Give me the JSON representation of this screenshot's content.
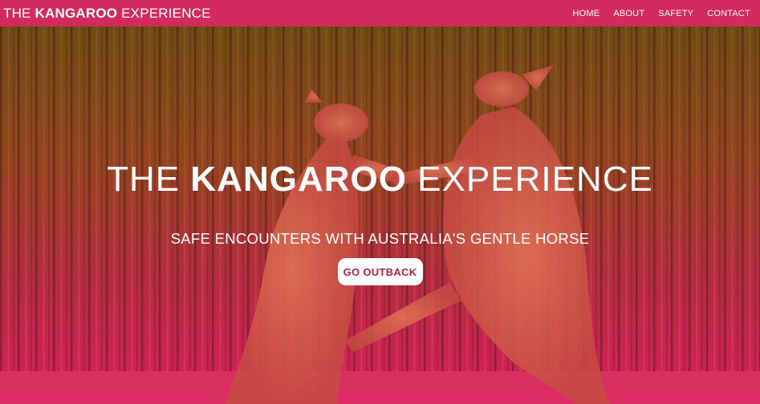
{
  "navbar": {
    "brand": {
      "prefix": "THE ",
      "bold": "KANGAROO",
      "suffix": " EXPERIENCE"
    },
    "links": [
      {
        "label": "HOME"
      },
      {
        "label": "ABOUT"
      },
      {
        "label": "SAFETY"
      },
      {
        "label": "CONTACT"
      }
    ]
  },
  "hero": {
    "title": {
      "prefix": "THE ",
      "bold": "KANGAROO",
      "suffix": " EXPERIENCE"
    },
    "subtitle": "SAFE ENCOUNTERS WITH AUSTRALIA'S GENTLE HORSE",
    "cta_label": "GO OUTBACK",
    "background_image": "two kangaroos boxing in front of a wooden fence, tinted orange to pink"
  },
  "colors": {
    "brand": "#d22a5c",
    "cta_text": "#b31f4a",
    "overlay_top": "#c9762a",
    "overlay_bottom": "#d81e5c"
  }
}
